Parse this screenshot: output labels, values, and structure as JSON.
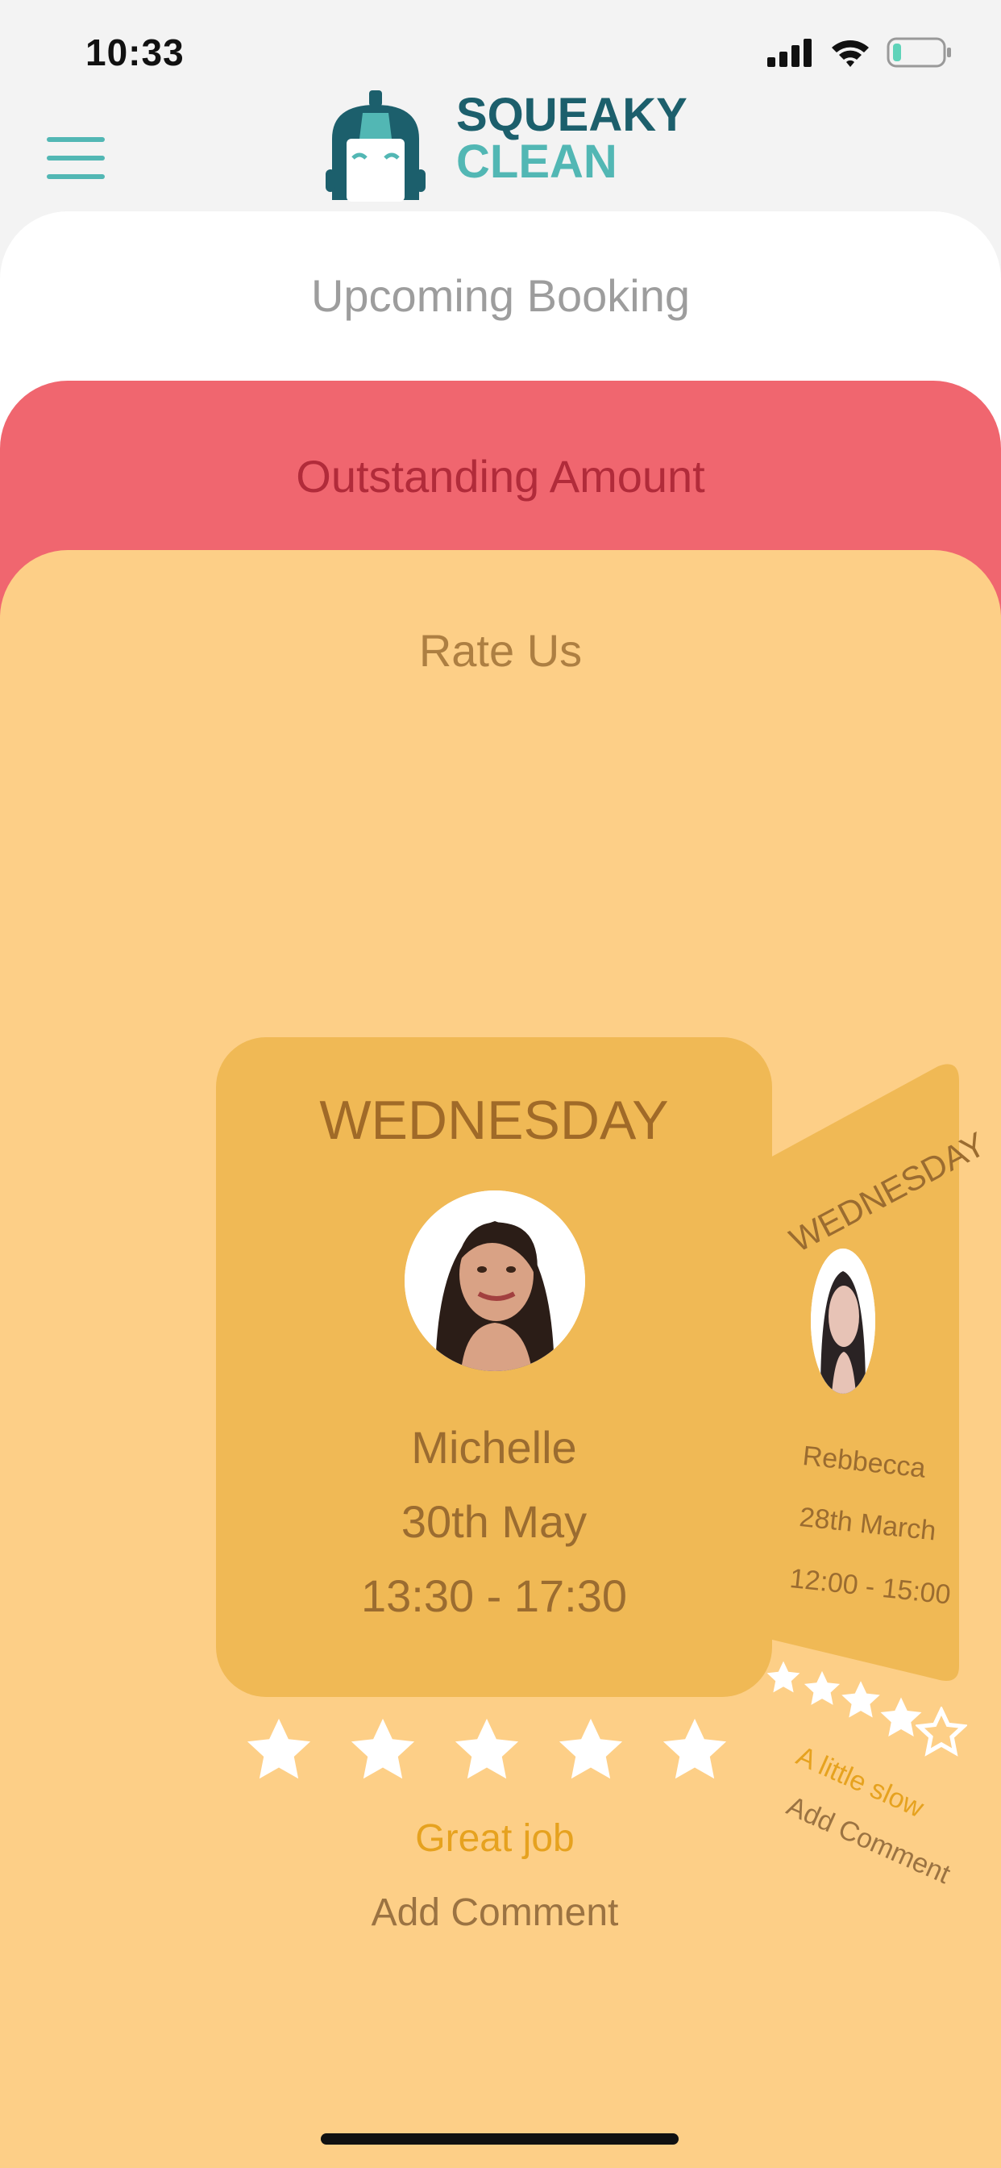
{
  "status_bar": {
    "time": "10:33"
  },
  "header": {
    "logo_line1": "SQUEAKY",
    "logo_line2": "CLEAN",
    "icons": {
      "menu": "hamburger-menu-icon",
      "logo": "squeaky-clean-logo-icon"
    },
    "colors": {
      "brand_dark": "#1c5f6c",
      "brand_teal": "#52b7b4"
    }
  },
  "cards": {
    "upcoming": {
      "title": "Upcoming Booking",
      "color": "#ffffff"
    },
    "outstanding": {
      "title": "Outstanding Amount",
      "color": "#f0666f"
    },
    "rate": {
      "title": "Rate Us",
      "color": "#fdcf87"
    }
  },
  "current_booking": {
    "day": "WEDNESDAY",
    "name": "Michelle",
    "date": "30th May",
    "time": "13:30 - 17:30",
    "rating": 5,
    "max_rating": 5,
    "rating_text": "Great job",
    "add_comment": "Add Comment"
  },
  "previous_booking": {
    "day": "WEDNESDAY",
    "name": "Rebbecca",
    "date": "28th March",
    "time": "12:00 - 15:00",
    "rating": 4,
    "max_rating": 5,
    "rating_text": "A little slow",
    "add_comment": "Add Comment"
  }
}
